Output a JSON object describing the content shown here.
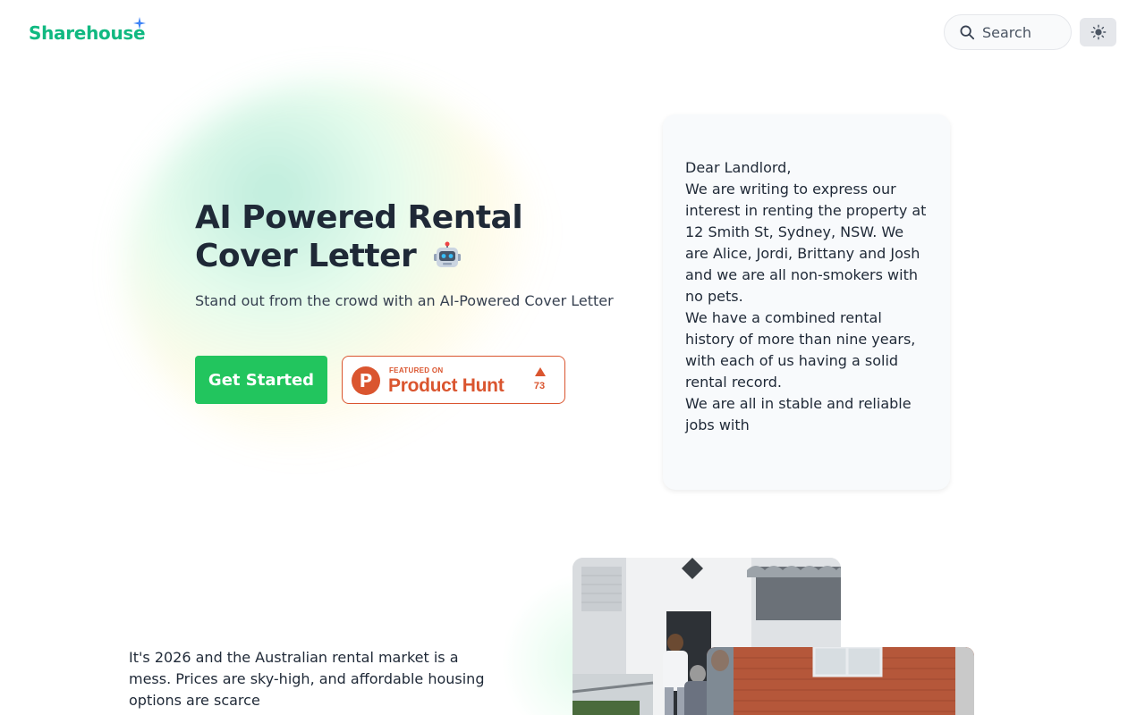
{
  "header": {
    "logo_text": "Sharehouse",
    "search_placeholder": "Search",
    "theme_toggle_icon": "sun-icon"
  },
  "hero": {
    "title_line1": "AI Powered Rental",
    "title_line2": "Cover Letter",
    "title_emoji": "robot-icon",
    "subtitle": "Stand out from the crowd with an AI-Powered Cover Letter",
    "cta_label": "Get Started",
    "product_hunt": {
      "small_label": "FEATURED ON",
      "name": "Product Hunt",
      "upvotes": "73"
    }
  },
  "letter": {
    "greeting": "Dear Landlord,",
    "paragraph1": "We are writing to express our interest in renting the property at 12 Smith St, Sydney, NSW. We are Alice, Jordi, Brittany and Josh and we are all non-smokers with no pets.",
    "paragraph2": "We have a combined rental history of more than nine years, with each of us having a solid rental record.",
    "paragraph3": "We are all in stable and reliable jobs with"
  },
  "section2": {
    "text": "It's 2026 and the Australian rental market is a mess. Prices are sky-high, and affordable housing options are scarce"
  },
  "colors": {
    "brand_green": "#10b981",
    "cta_green": "#22c55e",
    "product_hunt_orange": "#da552f",
    "sparkle_blue": "#3b82f6"
  }
}
